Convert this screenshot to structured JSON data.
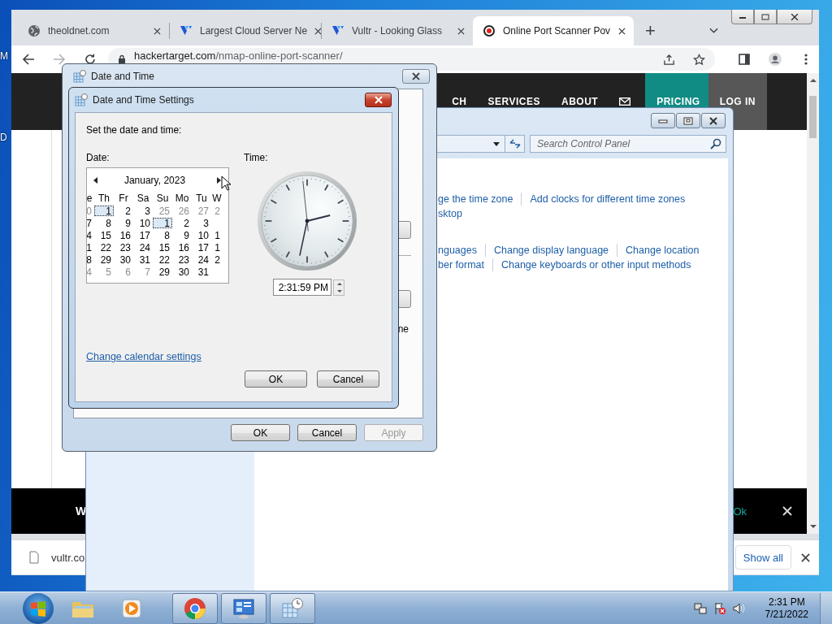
{
  "desktop": {
    "icon_labels": [
      "M",
      "D"
    ]
  },
  "browser": {
    "tabs": [
      {
        "title": "theoldnet.com",
        "kind": "globe",
        "selected": false
      },
      {
        "title": "Largest Cloud Server Ne",
        "kind": "vultr",
        "selected": false
      },
      {
        "title": "Vultr - Looking Glass",
        "kind": "vultr",
        "selected": false
      },
      {
        "title": "Online Port Scanner Pov",
        "kind": "target",
        "selected": true
      }
    ],
    "new_tab": "+",
    "address": {
      "host": "hackertarget.com",
      "path": "/nmap-online-port-scanner/"
    },
    "nav": [
      {
        "kind": "text",
        "label": "CH"
      },
      {
        "kind": "text",
        "label": "SERVICES"
      },
      {
        "kind": "text",
        "label": "ABOUT"
      },
      {
        "kind": "mail"
      },
      {
        "kind": "pricing",
        "label": "PRICING"
      },
      {
        "kind": "login",
        "label": "LOG IN"
      }
    ],
    "cookie_banner": {
      "text": "W",
      "action": "Ok"
    },
    "download_bar": {
      "file": "vultr.co",
      "show_all": "Show all"
    }
  },
  "control_panel": {
    "search": {
      "placeholder": "Search Control Panel"
    },
    "link_groups": [
      [
        [
          "ge the time zone",
          "Add clocks for different time zones"
        ],
        [
          "sktop"
        ]
      ],
      [
        [
          "nguages",
          "Change display language",
          "Change location"
        ],
        [
          "ber format",
          "Change keyboards or other input methods"
        ]
      ]
    ]
  },
  "date_time_dialog": {
    "title": "Date and Time",
    "partial_text": "ne",
    "buttons": [
      {
        "label": "OK",
        "disabled": false
      },
      {
        "label": "Cancel",
        "disabled": false
      },
      {
        "label": "Apply",
        "disabled": true
      }
    ]
  },
  "settings_dialog": {
    "title": "Date and Time Settings",
    "prompt": "Set the date and time:",
    "date_label": "Date:",
    "time_label": "Time:",
    "calendar": {
      "month": "January, 2023",
      "weekdays": [
        "e",
        "Th",
        "Fr",
        "Sa",
        "Su",
        "Mo",
        "Tu",
        "W"
      ],
      "weeks": [
        [
          {
            "day": "0",
            "dim": true,
            "selected": false
          },
          {
            "day": "1",
            "dim": false,
            "selected": true
          },
          {
            "day": "2",
            "dim": false,
            "selected": false
          },
          {
            "day": "3",
            "dim": false,
            "selected": false
          },
          {
            "day": "25",
            "dim": true,
            "selected": false
          },
          {
            "day": "26",
            "dim": true,
            "selected": false
          },
          {
            "day": "27",
            "dim": true,
            "selected": false
          },
          {
            "day": "2",
            "dim": true,
            "selected": false
          }
        ],
        [
          {
            "day": "7",
            "dim": false,
            "selected": false
          },
          {
            "day": "8",
            "dim": false,
            "selected": false
          },
          {
            "day": "9",
            "dim": false,
            "selected": false
          },
          {
            "day": "10",
            "dim": false,
            "selected": false
          },
          {
            "day": "1",
            "dim": false,
            "selected": true
          },
          {
            "day": "2",
            "dim": false,
            "selected": false
          },
          {
            "day": "3",
            "dim": false,
            "selected": false
          }
        ],
        [
          {
            "day": "4",
            "dim": false,
            "selected": false
          },
          {
            "day": "15",
            "dim": false,
            "selected": false
          },
          {
            "day": "16",
            "dim": false,
            "selected": false
          },
          {
            "day": "17",
            "dim": false,
            "selected": false
          },
          {
            "day": "8",
            "dim": false,
            "selected": false
          },
          {
            "day": "9",
            "dim": false,
            "selected": false
          },
          {
            "day": "10",
            "dim": false,
            "selected": false
          },
          {
            "day": "1",
            "dim": false,
            "selected": false
          }
        ],
        [
          {
            "day": "1",
            "dim": false,
            "selected": false
          },
          {
            "day": "22",
            "dim": false,
            "selected": false
          },
          {
            "day": "23",
            "dim": false,
            "selected": false
          },
          {
            "day": "24",
            "dim": false,
            "selected": false
          },
          {
            "day": "15",
            "dim": false,
            "selected": false
          },
          {
            "day": "16",
            "dim": false,
            "selected": false
          },
          {
            "day": "17",
            "dim": false,
            "selected": false
          },
          {
            "day": "1",
            "dim": false,
            "selected": false
          }
        ],
        [
          {
            "day": "8",
            "dim": false,
            "selected": false
          },
          {
            "day": "29",
            "dim": false,
            "selected": false
          },
          {
            "day": "30",
            "dim": false,
            "selected": false
          },
          {
            "day": "31",
            "dim": false,
            "selected": false
          },
          {
            "day": "22",
            "dim": false,
            "selected": false
          },
          {
            "day": "23",
            "dim": false,
            "selected": false
          },
          {
            "day": "24",
            "dim": false,
            "selected": false
          },
          {
            "day": "2",
            "dim": false,
            "selected": false
          }
        ],
        [
          {
            "day": "4",
            "dim": true,
            "selected": false
          },
          {
            "day": "5",
            "dim": true,
            "selected": false
          },
          {
            "day": "6",
            "dim": true,
            "selected": false
          },
          {
            "day": "7",
            "dim": true,
            "selected": false
          },
          {
            "day": "29",
            "dim": false,
            "selected": false
          },
          {
            "day": "30",
            "dim": false,
            "selected": false
          },
          {
            "day": "31",
            "dim": false,
            "selected": false
          }
        ]
      ]
    },
    "time": "2:31:59 PM",
    "link": "Change calendar settings",
    "buttons": [
      "OK",
      "Cancel"
    ]
  },
  "taskbar": {
    "apps": [
      {
        "kind": "explorer",
        "running": false
      },
      {
        "kind": "media",
        "running": false
      },
      {
        "kind": "chrome",
        "running": true
      },
      {
        "kind": "control",
        "running": true
      },
      {
        "kind": "clock",
        "running": true
      }
    ],
    "time": "2:31 PM",
    "date": "7/21/2022"
  }
}
